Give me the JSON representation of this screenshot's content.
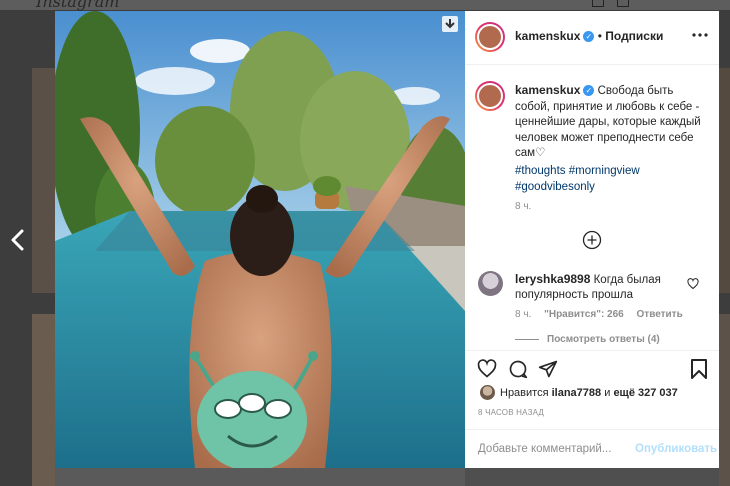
{
  "bg": {
    "logo_text": "Instagram"
  },
  "post": {
    "author": "kamenskux",
    "follow_status": "Подписки",
    "caption": "Свобода быть собой, принятие и любовь к себе - ценнейшие дары, которые каждый человек может преподнести себе сам",
    "heart_emoji": "♡",
    "hashtags": [
      "#thoughts",
      "#morningview",
      "#goodvibesonly"
    ],
    "caption_time": "8 ч."
  },
  "comment": {
    "author": "leryshka9898",
    "text": "Когда былая популярность прошла",
    "time": "8 ч.",
    "likes": "\"Нравится\": 266",
    "reply": "Ответить",
    "view_replies": "Посмотреть ответы (4)"
  },
  "actions": {
    "likes_prefix": "Нравится",
    "liked_by": "ilana7788",
    "likes_suffix": "и",
    "likes_others": "ещё 327 037",
    "post_time": "8 ЧАСОВ НАЗАД"
  },
  "composer": {
    "placeholder": "Добавьте комментарий...",
    "publish_label": "Опубликовать"
  },
  "icons": {
    "more": "more-icon",
    "like": "heart-icon",
    "comment": "comment-icon",
    "share": "share-icon",
    "save": "bookmark-icon",
    "add": "plus-circle-icon",
    "prev": "chevron-left-icon",
    "download": "download-icon"
  },
  "colors": {
    "link": "#3897f0",
    "hashtag": "#00376b",
    "text": "#262626",
    "muted": "#8e8e8e"
  }
}
